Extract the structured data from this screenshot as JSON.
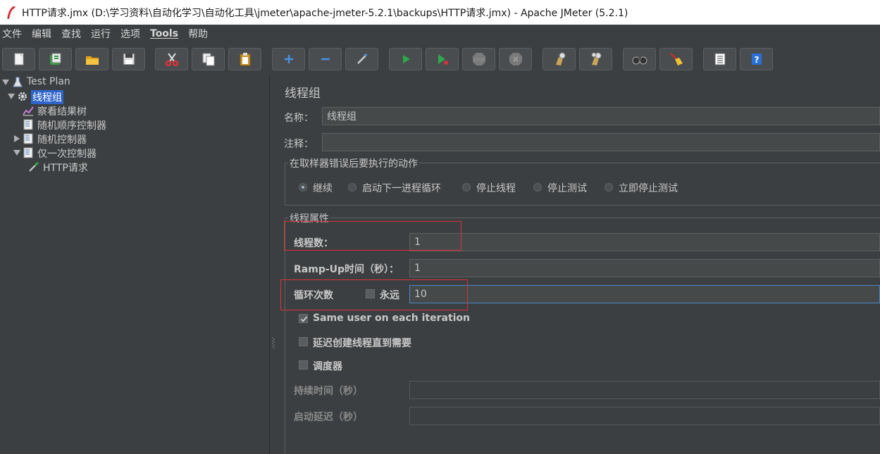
{
  "window": {
    "title": "HTTP请求.jmx (D:\\学习资料\\自动化学习\\自动化工具\\jmeter\\apache-jmeter-5.2.1\\backups\\HTTP请求.jmx) - Apache JMeter (5.2.1)"
  },
  "menu": {
    "items": [
      "文件",
      "编辑",
      "查找",
      "运行",
      "选项",
      "Tools",
      "帮助"
    ]
  },
  "toolbar": {
    "buttons": [
      "new-icon",
      "templates-icon",
      "open-icon",
      "save-icon",
      "cut-icon",
      "copy-icon",
      "paste-icon",
      "expand-icon",
      "collapse-icon",
      "toggle-icon",
      "start-icon",
      "start-no-pause-icon",
      "stop-icon",
      "shutdown-icon",
      "clear-icon",
      "clear-all-icon",
      "search-icon",
      "reset-search-icon",
      "function-helper-icon",
      "help-icon"
    ]
  },
  "tree": {
    "test_plan": "Test Plan",
    "thread_group": "线程组",
    "view_results_tree": "察看结果树",
    "random_order_controller": "随机顺序控制器",
    "random_controller": "随机控制器",
    "once_only_controller": "仅一次控制器",
    "http_request": "HTTP请求"
  },
  "panel": {
    "heading": "线程组",
    "name_label": "名称：",
    "name_value": "线程组",
    "comment_label": "注释：",
    "comment_value": "",
    "error_action_title": "在取样器错误后要执行的动作",
    "error_actions": [
      "继续",
      "启动下一进程循环",
      "停止线程",
      "停止测试",
      "立即停止测试"
    ],
    "error_action_selected": "继续",
    "thread_props_title": "线程属性",
    "threads_label": "线程数：",
    "threads_value": "1",
    "rampup_label": "Ramp-Up时间（秒）：",
    "rampup_value": "1",
    "loop_label": "循环次数",
    "forever_label": "永远",
    "forever_checked": false,
    "loop_value": "10",
    "same_user_label": "Same user on each iteration",
    "same_user_checked": true,
    "delay_create_label": "延迟创建线程直到需要",
    "delay_create_checked": false,
    "scheduler_label": "调度器",
    "scheduler_checked": false,
    "duration_label": "持续时间（秒）",
    "duration_value": "",
    "startup_delay_label": "启动延迟（秒）",
    "startup_delay_value": ""
  },
  "colors": {
    "background": "#3c3f41",
    "selection": "#2f65ca",
    "highlight_box": "#d9333b"
  }
}
